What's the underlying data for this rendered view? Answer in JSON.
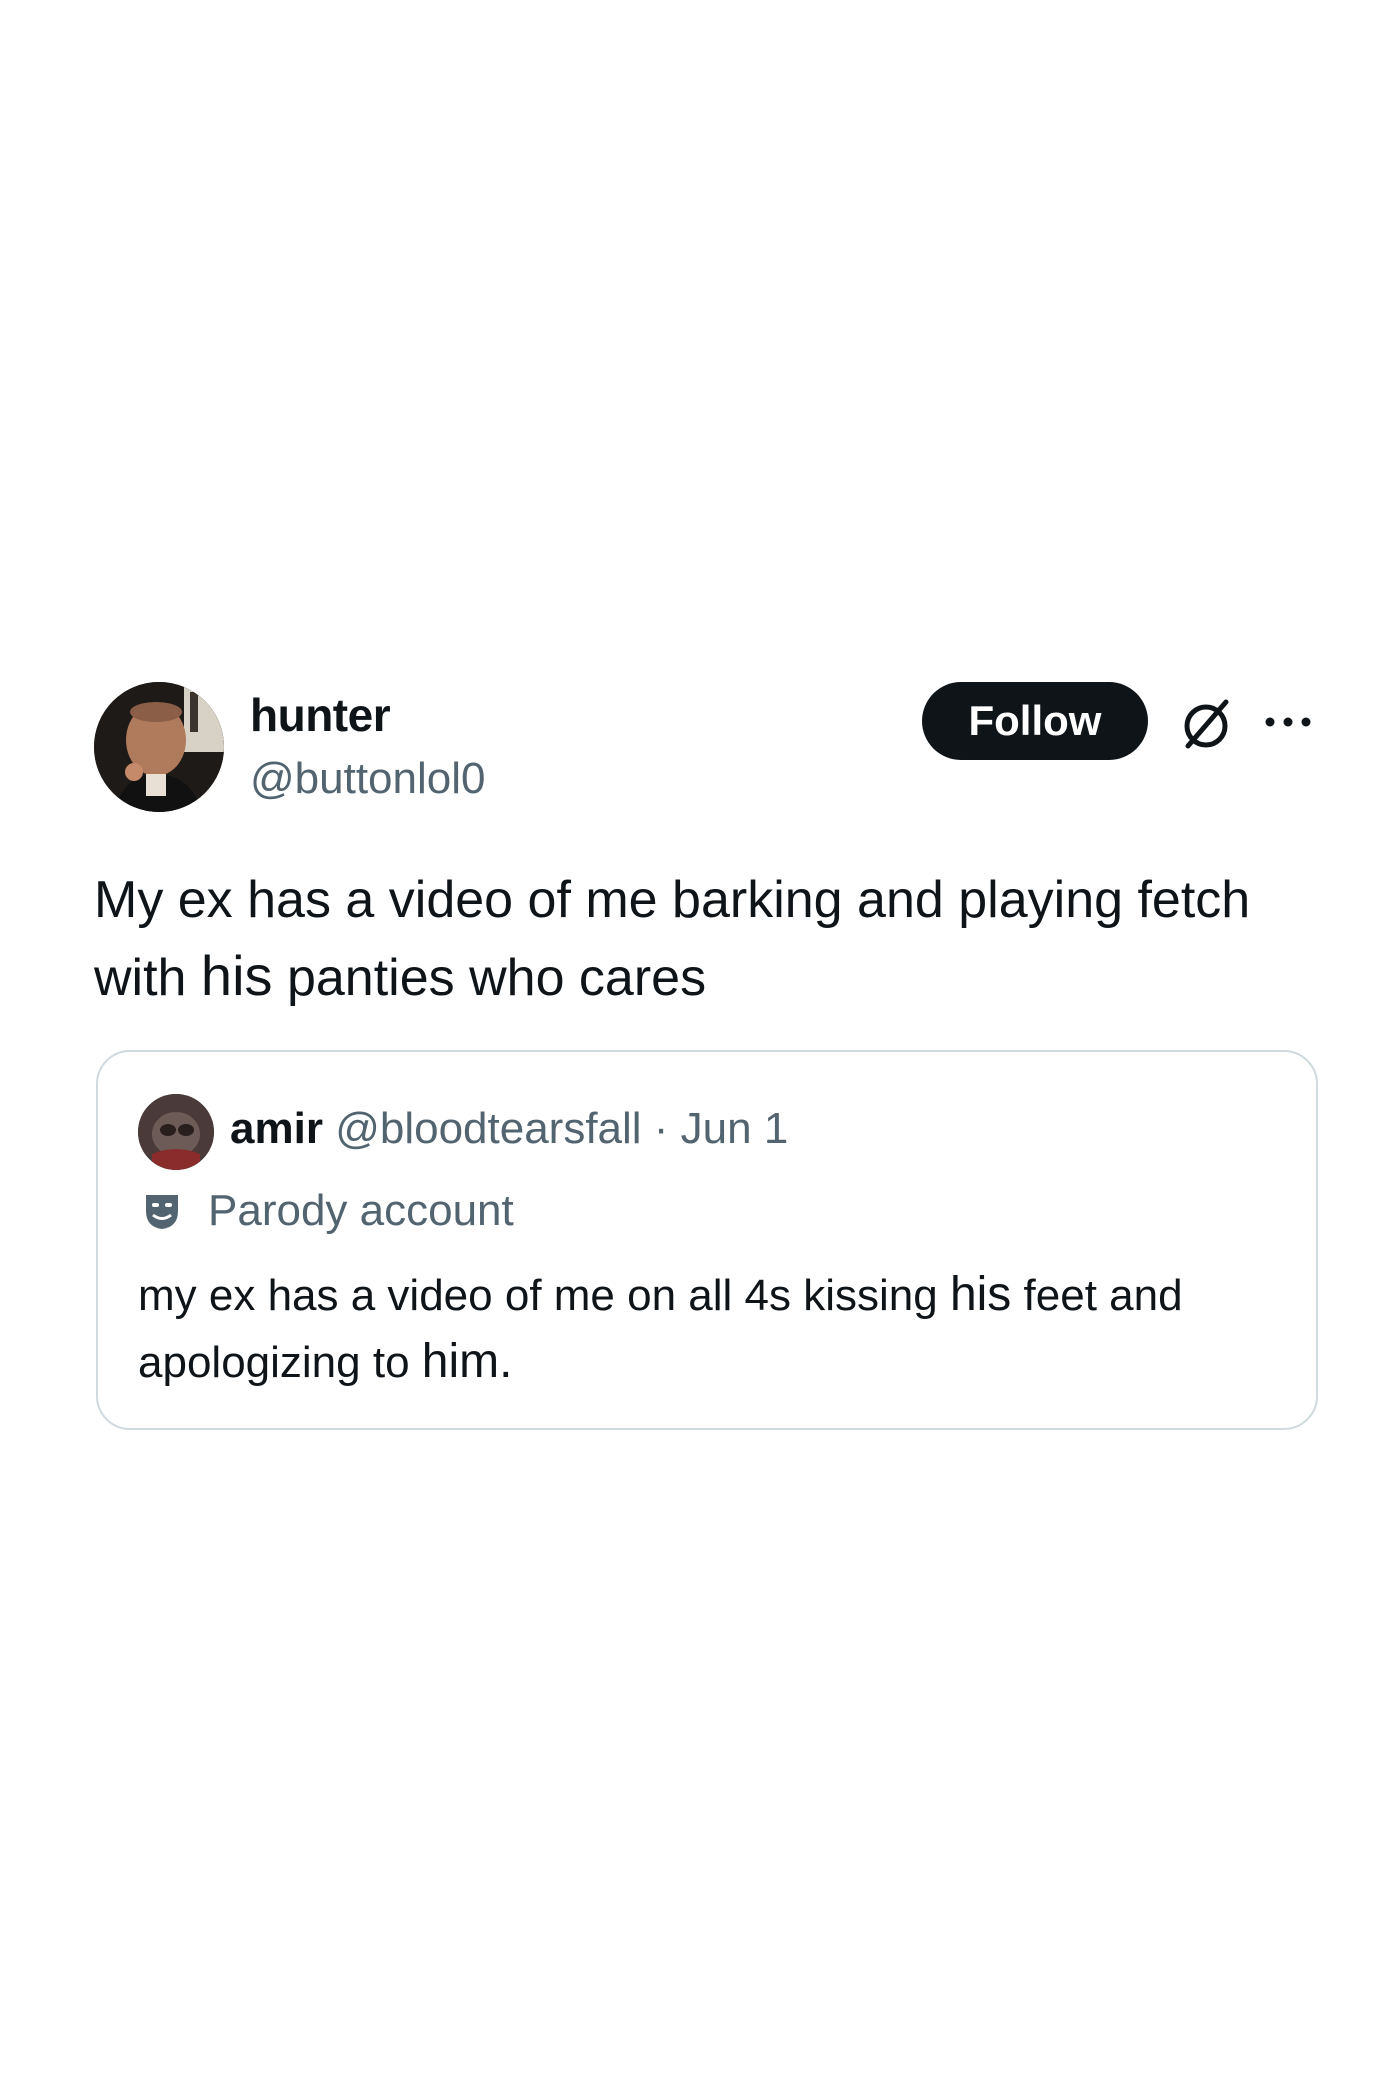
{
  "tweet": {
    "author": {
      "display_name": "hunter",
      "handle": "@buttonlol0"
    },
    "follow_label": "Follow",
    "text_before": "My ex has a video of me barking and playing fetch with ",
    "text_emph": "his",
    "text_after": " panties who cares"
  },
  "quote": {
    "author_name": "amir",
    "meta": "@bloodtearsfall · Jun 1",
    "badge_label": "Parody account",
    "text_part1": "my ex has a video of me on all 4s kissing ",
    "text_emph1": "his",
    "text_part2": " feet and apologizing to ",
    "text_emph2": "him."
  },
  "icons": {
    "grok": "grok-icon",
    "more": "more-icon",
    "parody": "theater-mask-icon"
  },
  "colors": {
    "text_primary": "#0f1419",
    "text_secondary": "#536471",
    "button_bg": "#0f1419",
    "border": "#cfd9de"
  }
}
